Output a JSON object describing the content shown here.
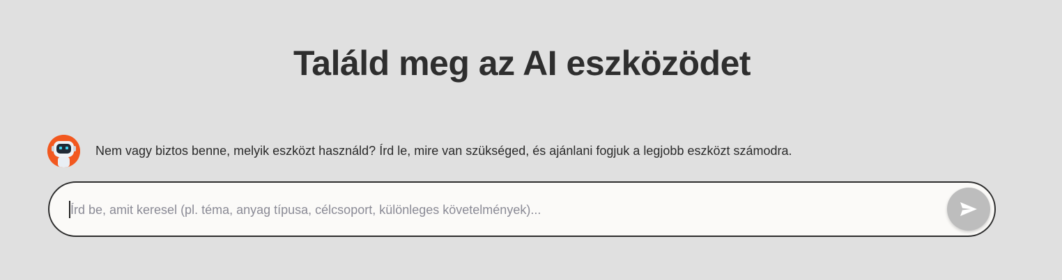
{
  "header": {
    "title": "Találd meg az AI eszközödet"
  },
  "assistant": {
    "avatar_icon": "robot-avatar-icon",
    "message": "Nem vagy biztos benne, melyik eszközt használd? Írd le, mire van szükséged, és ajánlani fogjuk a legjobb eszközt számodra."
  },
  "search": {
    "value": "",
    "placeholder": "Írd be, amit keresel (pl. téma, anyag típusa, célcsoport, különleges követelmények)...",
    "send_icon": "send-icon"
  },
  "colors": {
    "background": "#e0e0e0",
    "avatar_bg": "#f2581f",
    "input_bg": "#fbfaf8",
    "send_button_bg": "#bdbdbd"
  }
}
